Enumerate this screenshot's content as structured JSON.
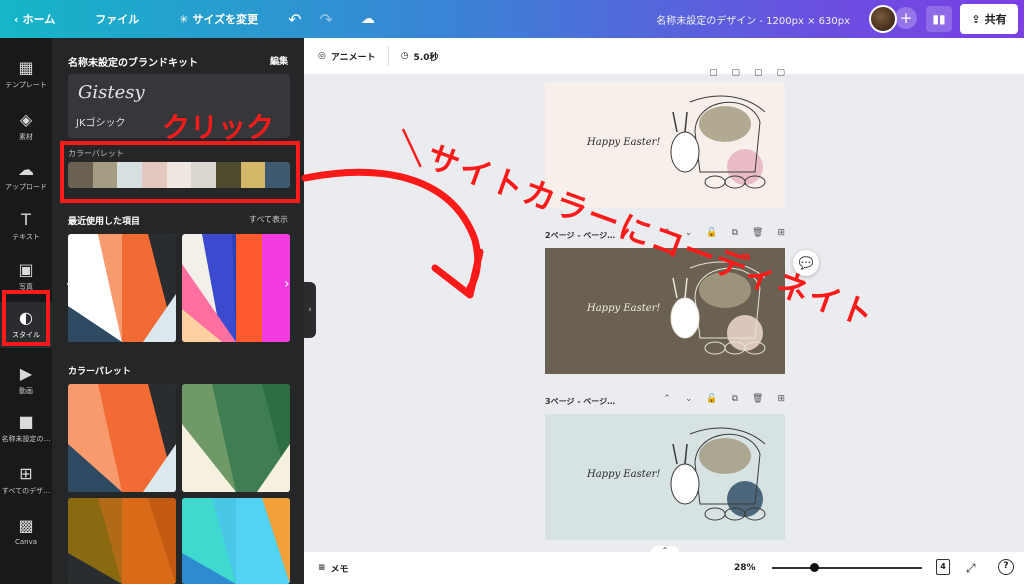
{
  "topbar": {
    "home": "ホーム",
    "file": "ファイル",
    "resize": "サイズを変更",
    "title": "名称未設定のデザイン - 1200px × 630px",
    "share": "共有"
  },
  "rail": [
    {
      "label": "テンプレート",
      "icon": "template-icon",
      "glyph": "▦"
    },
    {
      "label": "素材",
      "icon": "elements-icon",
      "glyph": "◈"
    },
    {
      "label": "アップロード",
      "icon": "upload-icon",
      "glyph": "☁"
    },
    {
      "label": "テキスト",
      "icon": "text-icon",
      "glyph": "T"
    },
    {
      "label": "写真",
      "icon": "photo-icon",
      "glyph": "▣"
    },
    {
      "label": "スタイル",
      "icon": "palette-icon",
      "glyph": "◐"
    },
    {
      "label": "動画",
      "icon": "video-icon",
      "glyph": "▶"
    },
    {
      "label": "名称未設定の…",
      "icon": "folder-icon",
      "glyph": "■"
    },
    {
      "label": "すべてのデザ…",
      "icon": "grid-icon",
      "glyph": "⊞"
    },
    {
      "label": "Canva",
      "icon": "canva-icon",
      "glyph": "▩"
    }
  ],
  "panel": {
    "brand_title": "名称未設定のブランドキット",
    "edit": "編集",
    "signature": "Gistesy",
    "font_name": "JKゴシック",
    "palette_label": "カラーパレット",
    "palette_colors": [
      "#6b6152",
      "#a49c83",
      "#d6e0e0",
      "#e3c8c0",
      "#f1e7e2",
      "#d9d7d0",
      "#4e4a2c",
      "#d4b86a",
      "#3d5a70"
    ],
    "recent": "最近使用した項目",
    "show_all": "すべて表示",
    "palette_heading": "カラーパレット"
  },
  "toolbar": {
    "animate": "アニメート",
    "duration": "5.0秒"
  },
  "pages": [
    {
      "label": "",
      "bg": "#f7efea",
      "circle": "#e7b6c4"
    },
    {
      "label": "2ページ - ページ…",
      "bg": "#6b6152",
      "circle": "#e8d2c8"
    },
    {
      "label": "3ページ - ページ…",
      "bg": "#d7e2e2",
      "circle": "#3d5a70"
    }
  ],
  "design_text": "Happy Easter!",
  "bottombar": {
    "memo": "メモ",
    "zoom": "28%",
    "page_count": "4"
  },
  "annotations": {
    "click": "クリック",
    "site_color": "＼サイトカラーにコーディネイト"
  }
}
